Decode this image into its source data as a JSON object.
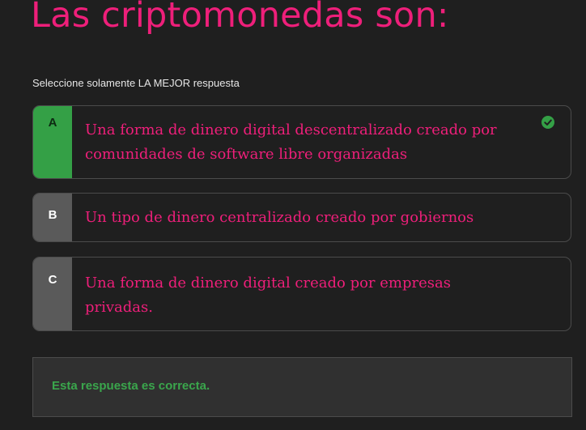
{
  "question": {
    "title": "Las criptomonedas son:",
    "instruction": "Seleccione solamente LA MEJOR respuesta"
  },
  "options": [
    {
      "letter": "A",
      "text": "Una forma de dinero digital descentralizado creado por comunidades de software libre organizadas",
      "selected": true,
      "status": "correct",
      "icon": "check-circle-icon"
    },
    {
      "letter": "B",
      "text": "Un tipo de dinero centralizado creado por gobiernos",
      "selected": false
    },
    {
      "letter": "C",
      "text": "Una forma de dinero digital creado por empresas privadas.",
      "selected": false
    }
  ],
  "feedback": {
    "text": "Esta respuesta es correcta."
  },
  "colors": {
    "background": "#1f1f1f",
    "accent": "#ee1f7a",
    "correct": "#34a046",
    "neutral_letter_box": "#5a5a5a",
    "border": "#4b4b4b"
  }
}
